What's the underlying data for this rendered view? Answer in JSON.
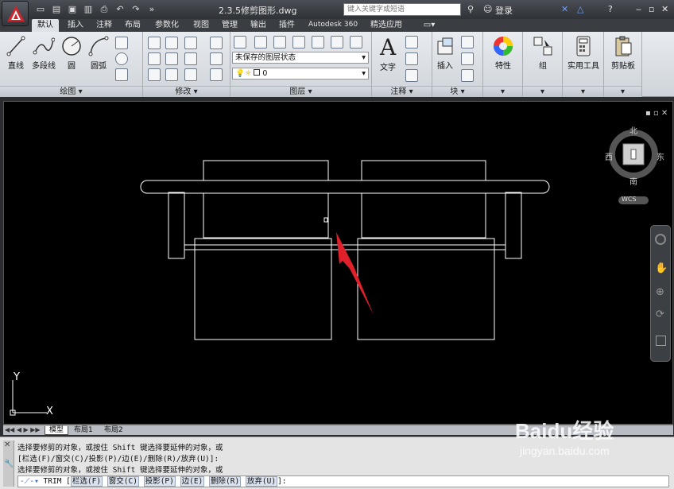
{
  "title": {
    "document": "2.3.5修剪图形.dwg",
    "search_placeholder": "键入关键字或短语",
    "login": "登录"
  },
  "tabs": [
    "默认",
    "插入",
    "注释",
    "布局",
    "参数化",
    "视图",
    "管理",
    "输出",
    "插件",
    "Autodesk 360",
    "精选应用"
  ],
  "ribbon": {
    "draw": {
      "line": "直线",
      "polyline": "多段线",
      "circle": "圆",
      "arc": "圆弧",
      "label": "绘图"
    },
    "modify": {
      "label": "修改"
    },
    "layers": {
      "state": "未保存的图层状态",
      "current": "0",
      "label": "图层"
    },
    "annotation": {
      "text": "文字",
      "label": "注释"
    },
    "block": {
      "insert": "插入",
      "label": "块"
    },
    "properties": {
      "label": "特性"
    },
    "groups": {
      "label": "组"
    },
    "utilities": {
      "label": "实用工具"
    },
    "clipboard": {
      "label": "剪贴板"
    }
  },
  "viewcube": {
    "north": "北",
    "south": "南",
    "east": "东",
    "west": "西",
    "wcs": "WCS"
  },
  "ucs": {
    "x": "X",
    "y": "Y"
  },
  "layout_tabs": [
    "模型",
    "布局1",
    "布局2"
  ],
  "command": {
    "history": [
      "选择要修剪的对象，或按住 Shift 键选择要延伸的对象，或",
      "[栏选(F)/窗交(C)/投影(P)/边(E)/删除(R)/放弃(U)]:",
      "选择要修剪的对象，或按住 Shift 键选择要延伸的对象，或"
    ],
    "prompt": "TRIM [",
    "options": [
      "栏选(F)",
      "窗交(C)",
      "投影(P)",
      "边(E)",
      "删除(R)",
      "放弃(U)"
    ],
    "suffix": "]:"
  },
  "watermark": {
    "brand": "Baidu经验",
    "url": "jingyan.baidu.com"
  },
  "colors": {
    "canvas": "#000000",
    "arrow": "#e0202a",
    "ribbon": "#dfe3e8",
    "drawing": "#ffffff"
  }
}
